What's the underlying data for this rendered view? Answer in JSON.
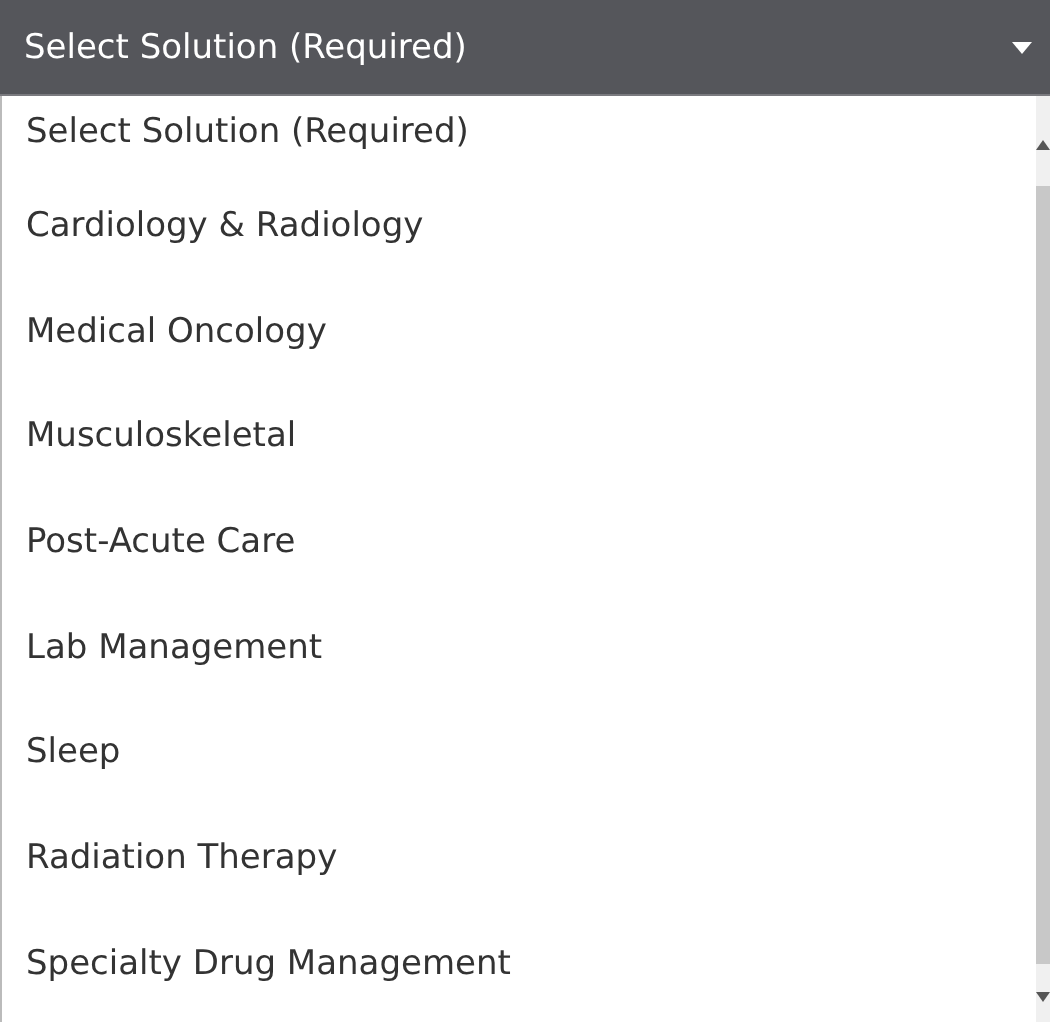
{
  "select": {
    "value": "Select Solution (Required)"
  },
  "options": [
    {
      "label": "Select Solution (Required)"
    },
    {
      "label": "Cardiology & Radiology"
    },
    {
      "label": "Medical Oncology"
    },
    {
      "label": "Musculoskeletal"
    },
    {
      "label": "Post-Acute Care"
    },
    {
      "label": "Lab Management"
    },
    {
      "label": "Sleep"
    },
    {
      "label": "Radiation Therapy"
    },
    {
      "label": "Specialty Drug Management"
    }
  ]
}
